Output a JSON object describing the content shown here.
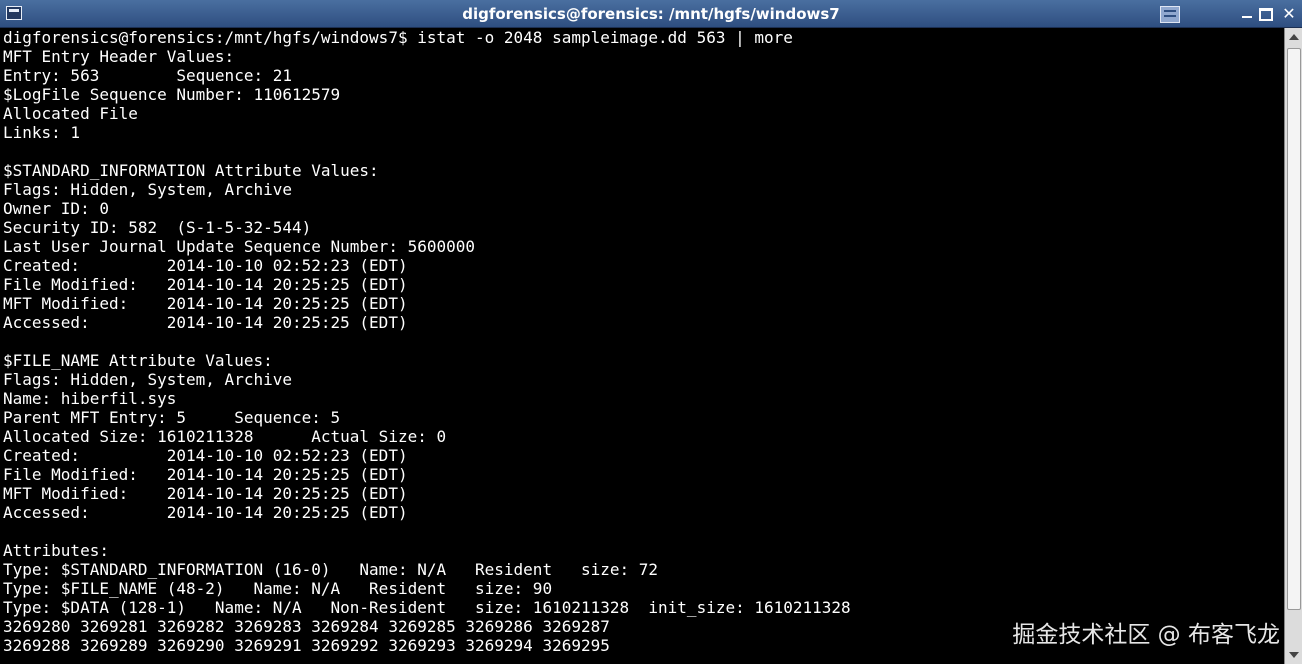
{
  "window": {
    "title": "digforensics@forensics: /mnt/hgfs/windows7"
  },
  "terminal": {
    "lines": [
      "digforensics@forensics:/mnt/hgfs/windows7$ istat -o 2048 sampleimage.dd 563 | more",
      "MFT Entry Header Values:",
      "Entry: 563        Sequence: 21",
      "$LogFile Sequence Number: 110612579",
      "Allocated File",
      "Links: 1",
      "",
      "$STANDARD_INFORMATION Attribute Values:",
      "Flags: Hidden, System, Archive",
      "Owner ID: 0",
      "Security ID: 582  (S-1-5-32-544)",
      "Last User Journal Update Sequence Number: 5600000",
      "Created:         2014-10-10 02:52:23 (EDT)",
      "File Modified:   2014-10-14 20:25:25 (EDT)",
      "MFT Modified:    2014-10-14 20:25:25 (EDT)",
      "Accessed:        2014-10-14 20:25:25 (EDT)",
      "",
      "$FILE_NAME Attribute Values:",
      "Flags: Hidden, System, Archive",
      "Name: hiberfil.sys",
      "Parent MFT Entry: 5     Sequence: 5",
      "Allocated Size: 1610211328      Actual Size: 0",
      "Created:         2014-10-10 02:52:23 (EDT)",
      "File Modified:   2014-10-14 20:25:25 (EDT)",
      "MFT Modified:    2014-10-14 20:25:25 (EDT)",
      "Accessed:        2014-10-14 20:25:25 (EDT)",
      "",
      "Attributes:",
      "Type: $STANDARD_INFORMATION (16-0)   Name: N/A   Resident   size: 72",
      "Type: $FILE_NAME (48-2)   Name: N/A   Resident   size: 90",
      "Type: $DATA (128-1)   Name: N/A   Non-Resident   size: 1610211328  init_size: 1610211328",
      "3269280 3269281 3269282 3269283 3269284 3269285 3269286 3269287",
      "3269288 3269289 3269290 3269291 3269292 3269293 3269294 3269295"
    ]
  },
  "watermark": "掘金技术社区 @ 布客飞龙",
  "icons": {
    "menu": "terminal-window-icon",
    "shade": "window-shade-icon",
    "minimize": "minimize-icon",
    "maximize": "maximize-icon",
    "close": "close-icon"
  },
  "colors": {
    "titlebar": "#3a5f93",
    "terminal_bg": "#000000",
    "terminal_fg": "#ffffff"
  }
}
